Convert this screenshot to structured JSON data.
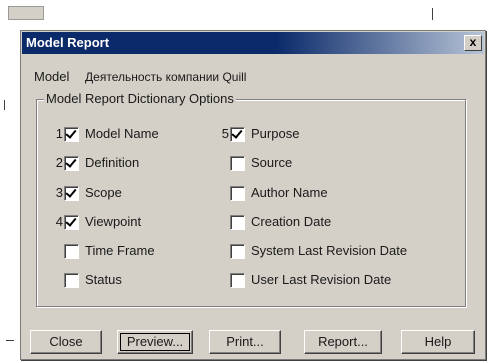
{
  "dialog": {
    "title": "Model Report",
    "close_glyph": "x",
    "model_label": "Model",
    "model_value": "Деятельность компании Quill"
  },
  "group": {
    "legend": "Model Report Dictionary Options",
    "left_options": [
      {
        "num": "1",
        "label": "Model Name",
        "checked": true
      },
      {
        "num": "2",
        "label": "Definition",
        "checked": true
      },
      {
        "num": "3",
        "label": "Scope",
        "checked": true
      },
      {
        "num": "4",
        "label": "Viewpoint",
        "checked": true
      },
      {
        "num": "",
        "label": "Time Frame",
        "checked": false
      },
      {
        "num": "",
        "label": "Status",
        "checked": false
      }
    ],
    "right_options": [
      {
        "num": "5",
        "label": "Purpose",
        "checked": true
      },
      {
        "num": "",
        "label": "Source",
        "checked": false
      },
      {
        "num": "",
        "label": "Author Name",
        "checked": false
      },
      {
        "num": "",
        "label": "Creation Date",
        "checked": false
      },
      {
        "num": "",
        "label": "System Last Revision Date",
        "checked": false
      },
      {
        "num": "",
        "label": "User Last Revision Date",
        "checked": false
      }
    ]
  },
  "buttons": {
    "close": "Close",
    "preview": "Preview...",
    "print": "Print...",
    "report": "Report...",
    "help": "Help"
  },
  "colors": {
    "titlebar_start": "#0a2a6a",
    "titlebar_end": "#b7c4d6",
    "dialog_face": "#d4d0c8"
  }
}
